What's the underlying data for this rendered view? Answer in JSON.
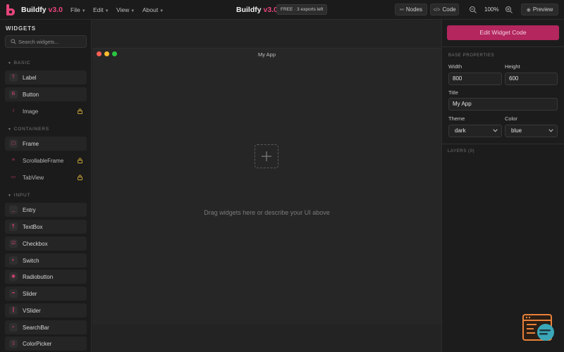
{
  "header": {
    "brand": "Buildfy",
    "version": "v3.0",
    "menus": [
      "File",
      "Edit",
      "View",
      "About"
    ],
    "center_title": "Buildfy",
    "center_version": "v3.0",
    "plan_badge": "FREE · 3 exports left",
    "nodes_label": "Nodes",
    "code_label": "Code",
    "zoom": "100%",
    "preview_label": "Preview"
  },
  "sidebar": {
    "title": "WIDGETS",
    "search_placeholder": "Search widgets...",
    "sections": [
      {
        "title": "BASIC",
        "items": [
          {
            "label": "Label",
            "icon": "T",
            "locked": false
          },
          {
            "label": "Button",
            "icon": "B",
            "locked": false
          },
          {
            "label": "Image",
            "icon": "I",
            "locked": true
          }
        ]
      },
      {
        "title": "CONTAINERS",
        "items": [
          {
            "label": "Frame",
            "icon": "▢",
            "locked": false
          },
          {
            "label": "ScrollableFrame",
            "icon": "≡",
            "locked": true
          },
          {
            "label": "TabView",
            "icon": "▭",
            "locked": true
          }
        ]
      },
      {
        "title": "INPUT",
        "items": [
          {
            "label": "Entry",
            "icon": "_",
            "locked": false
          },
          {
            "label": "TextBox",
            "icon": "¶",
            "locked": false
          },
          {
            "label": "Checkbox",
            "icon": "☑",
            "locked": false
          },
          {
            "label": "Switch",
            "icon": "◐",
            "locked": false
          },
          {
            "label": "Radiobutton",
            "icon": "◉",
            "locked": false
          },
          {
            "label": "Slider",
            "icon": "━",
            "locked": false
          },
          {
            "label": "VSlider",
            "icon": "┃",
            "locked": false
          },
          {
            "label": "SearchBar",
            "icon": "⌕",
            "locked": false
          },
          {
            "label": "ColorPicker",
            "icon": "▯",
            "locked": false
          }
        ]
      }
    ]
  },
  "canvas": {
    "window_title": "My App",
    "drop_hint": "Drag widgets here or describe your UI above"
  },
  "properties": {
    "edit_button": "Edit Widget Code",
    "section_title": "BASE PROPERTIES",
    "width_label": "Width",
    "width_value": "800",
    "height_label": "Height",
    "height_value": "600",
    "title_label": "Title",
    "title_value": "My App",
    "theme_label": "Theme",
    "theme_value": "dark",
    "color_label": "Color",
    "color_value": "blue",
    "layers_title": "LAYERS (0)"
  },
  "colors": {
    "accent": "#e8457a",
    "accent_button": "#b3265e",
    "traffic_red": "#ff5f57",
    "traffic_yellow": "#febc2e",
    "traffic_green": "#28c840",
    "helper_orange": "#e8813a",
    "helper_teal": "#3aa7b8"
  },
  "icons": [
    "buildfy-logo-icon",
    "chevron-down-icon",
    "nodes-icon",
    "code-icon",
    "zoom-out-icon",
    "zoom-in-icon",
    "eye-icon",
    "search-icon",
    "lock-icon",
    "plus-icon",
    "helper-bot-icon"
  ]
}
